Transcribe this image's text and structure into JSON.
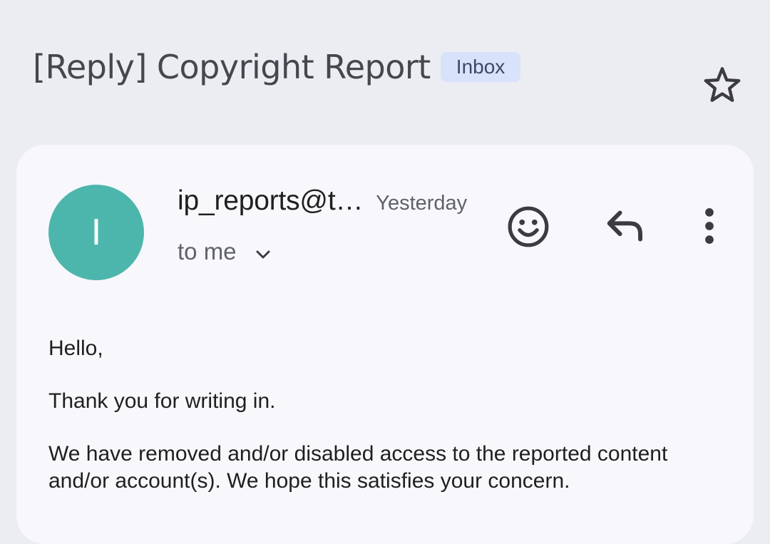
{
  "email": {
    "subject": "[Reply] Copyright Report",
    "label": "Inbox",
    "sender_initial": "I",
    "sender": "ip_reports@t…",
    "date": "Yesterday",
    "recipient": "to me",
    "body": [
      "Hello,",
      "Thank you for writing in.",
      "We have removed and/or disabled access to the reported content and/or account(s). We hope this satisfies your concern."
    ]
  },
  "icons": {
    "star": "star-outline-icon",
    "expand": "chevron-down-icon",
    "emoji": "smiley-icon",
    "reply": "reply-icon",
    "more": "more-vert-icon"
  },
  "colors": {
    "background": "#ECECF3",
    "card": "#F8F7FC",
    "avatar": "#4DB6AC",
    "label_chip": "#D8E3FB",
    "icon": "#3C3C40"
  }
}
